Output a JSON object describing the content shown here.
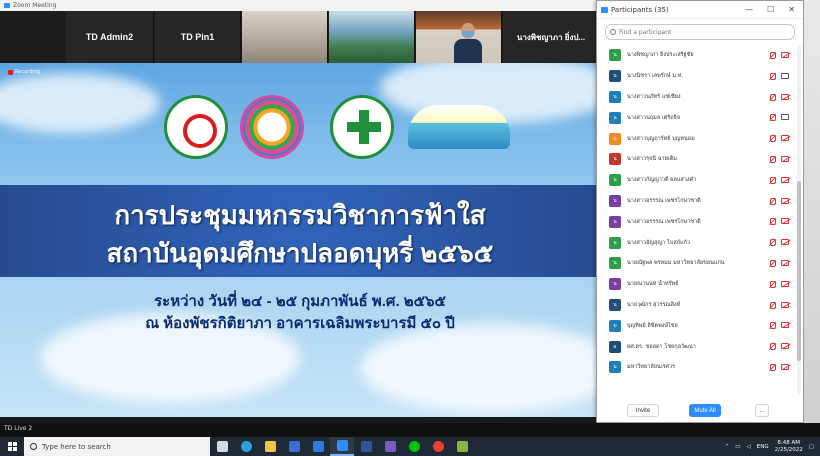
{
  "window": {
    "title": "Zoom Meeting"
  },
  "video_strip": {
    "tiles": [
      {
        "label": "TD Admin2"
      },
      {
        "label": "TD Pin1"
      },
      {
        "label": ""
      },
      {
        "label": ""
      },
      {
        "label": ""
      },
      {
        "label": "นางพิชญาภา ยิ่งป..."
      }
    ]
  },
  "recording": {
    "label": "Recording"
  },
  "slide": {
    "title_line1": "การประชุมมหกรรมวิชาการฟ้าใส",
    "title_line2": "สถาบันอุดมศึกษาปลอดบุหรี่ ๒๕๖๕",
    "date_line": "ระหว่าง วันที่ ๒๔ - ๒๕ กุมภาพันธ์ พ.ศ. ๒๕๖๕",
    "venue_line": "ณ ห้องพัชรกิติยาภา อาคารเฉลิมพระบารมี ๕๐ ปี"
  },
  "active_speaker": {
    "label": "TD Live 2"
  },
  "participants": {
    "title": "Participants (35)",
    "controls": [
      "—",
      "☐",
      "✕"
    ],
    "search_placeholder": "Find a participant",
    "items": [
      {
        "initial": "น",
        "name": "นางพิชญาภา ยิ่งประเสริฐชัย",
        "color": "#2e9e4a",
        "cam_on": false
      },
      {
        "initial": "น",
        "name": "นางนิชรา เลพรักษ์ ม.ท.",
        "color": "#1f4e79",
        "cam_on": true
      },
      {
        "initial": "น",
        "name": "นางสาวนภัทร์ แซ่เซี่ยง",
        "color": "#1e7fb8",
        "cam_on": false
      },
      {
        "initial": "น",
        "name": "นางสาวนฤมล เศร้ถจิจ",
        "color": "#1e7fb8",
        "cam_on": true
      },
      {
        "initial": "น",
        "name": "นางสาวบุญฤาร์ทย์ บุญหนอม",
        "color": "#f08a24",
        "cam_on": false
      },
      {
        "initial": "น",
        "name": "นางสาวรุจนี ฉายเต็ม",
        "color": "#c0392b",
        "cam_on": false
      },
      {
        "initial": "น",
        "name": "นางสาวกัญญาวดี ผลแสวงค่ำ",
        "color": "#2e9e4a",
        "cam_on": false
      },
      {
        "initial": "น",
        "name": "นางสาวอรรรณ เพชรโกษาชาติ",
        "color": "#7b3fa0",
        "cam_on": false
      },
      {
        "initial": "น",
        "name": "นางสาวอรรรณ เพชรโกษาชาติ",
        "color": "#7b3fa0",
        "cam_on": false
      },
      {
        "initial": "น",
        "name": "นางสาวอัญสุญา โบสถ์แก้ว",
        "color": "#2e9e4a",
        "cam_on": false
      },
      {
        "initial": "น",
        "name": "นายณัฐพล พรหมม มหาวิทยาลัยขอนแก่น",
        "color": "#2e9e4a",
        "cam_on": false
      },
      {
        "initial": "น",
        "name": "นายณานนท น้ำทรัพย์",
        "color": "#7b3fa0",
        "cam_on": false
      },
      {
        "initial": "น",
        "name": "นายวุฒิกร สุวรรณสิงห์",
        "color": "#1f4e79",
        "cam_on": false
      },
      {
        "initial": "บ",
        "name": "บุญทิพย์ ลิขิตพงษ์ไชย",
        "color": "#1e7fb8",
        "cam_on": false
      },
      {
        "initial": "ผ",
        "name": "ผศ.ดร. ชลลดา โชยกุลวัฒนา",
        "color": "#1f4e79",
        "cam_on": false
      },
      {
        "initial": "ม",
        "name": "มหาวิทยาลัยนเรศวร",
        "color": "#1e7fb8",
        "cam_on": false
      }
    ],
    "invite_label": "Invite",
    "mute_all_label": "Mute All",
    "more_label": "..."
  },
  "taskbar": {
    "search_placeholder": "Type here to search",
    "lang": "ENG",
    "time": "8:48 AM",
    "date": "2/25/2022",
    "apps": [
      {
        "icon": "task-view-icon",
        "color": "#cfd8e3"
      },
      {
        "icon": "edge-icon",
        "color": "#2aa0d6"
      },
      {
        "icon": "file-explorer-icon",
        "color": "#f4c542"
      },
      {
        "icon": "store-icon",
        "color": "#3a6fd6"
      },
      {
        "icon": "mail-icon",
        "color": "#2c7be5"
      },
      {
        "icon": "zoom-icon",
        "color": "#2d8cff"
      },
      {
        "icon": "word-icon",
        "color": "#2b579a"
      },
      {
        "icon": "photos-icon",
        "color": "#7a5cc4"
      },
      {
        "icon": "line-icon",
        "color": "#00c300"
      },
      {
        "icon": "chrome-icon",
        "color": "#e94235"
      },
      {
        "icon": "vegas-icon",
        "color": "#8bb43a"
      }
    ]
  }
}
